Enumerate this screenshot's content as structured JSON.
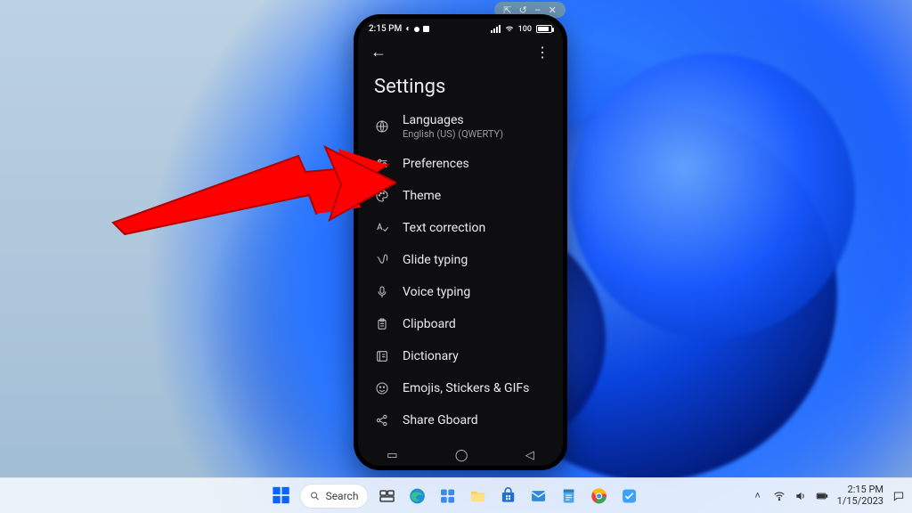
{
  "scrcpy_controls": {
    "pin": "⇱",
    "back": "↺",
    "min": "–",
    "close": "✕"
  },
  "phone": {
    "status": {
      "time": "2:15 PM",
      "do_not_disturb": "◐",
      "battery_pct": "100"
    },
    "header": {
      "back": "←",
      "more": "⋮"
    },
    "title": "Settings",
    "items": [
      {
        "icon": "globe",
        "label": "Languages",
        "sub": "English (US) (QWERTY)"
      },
      {
        "icon": "sliders",
        "label": "Preferences"
      },
      {
        "icon": "palette",
        "label": "Theme"
      },
      {
        "icon": "spellcheck",
        "label": "Text correction"
      },
      {
        "icon": "gesture",
        "label": "Glide typing"
      },
      {
        "icon": "mic",
        "label": "Voice typing"
      },
      {
        "icon": "clipboard",
        "label": "Clipboard"
      },
      {
        "icon": "dictionary",
        "label": "Dictionary"
      },
      {
        "icon": "emoji",
        "label": "Emojis, Stickers & GIFs"
      },
      {
        "icon": "share",
        "label": "Share Gboard"
      }
    ],
    "nav": {
      "recent": "▭",
      "home": "◯",
      "back": "◁"
    }
  },
  "taskbar": {
    "search_label": "Search",
    "pinned": [
      "start",
      "search",
      "taskview",
      "edge",
      "widgets",
      "explorer",
      "store",
      "mail",
      "notepad",
      "chrome",
      "myapp"
    ],
    "tray": {
      "chevron": "˄",
      "wifi": true,
      "volume": true,
      "battery": true
    },
    "time": "2:15 PM",
    "date": "1/15/2023"
  },
  "annotation": {
    "points_to": "Preferences"
  }
}
